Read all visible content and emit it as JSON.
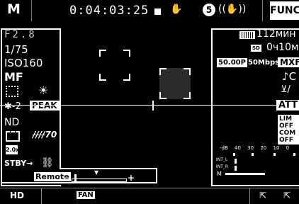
{
  "top": {
    "mode": "M",
    "timecode": "0:04:03:25",
    "rec_icon": "stop-square-icon",
    "stabilizer_icon": "hand-stabilizer-icon",
    "assign_number": "5",
    "func_label": "FUNC."
  },
  "left": {
    "aperture": "F2.8",
    "shutter": "1/75",
    "iso": "ISO160",
    "mf": "MF",
    "focus_guide_icon": "focus-guide-icon",
    "white_balance_icon": "sun-icon",
    "peaking_prefix": "-2",
    "peaking_label": "PEAK",
    "nd_label": "ND",
    "frame_icon": "frame-icon",
    "zebra_value": "70",
    "zoom_icon": "2.0x",
    "standby_label": "STBY",
    "remote_label": "Remote",
    "exposure_minus": "−",
    "exposure_plus": "+"
  },
  "right": {
    "battery_time": "112мин",
    "card_label": "SD",
    "card_time": "0ч10м",
    "framerate": "50.00P",
    "bitrate": "50Mbps",
    "format": "MXF",
    "audio_label": "♪C",
    "att_label": "ATT",
    "lim_label": "LIM OFF",
    "com_label": "COM OFF",
    "meter_scale": [
      "-dB",
      "40",
      "30",
      "20",
      "10",
      "0"
    ],
    "meter_int_l": "INT_L",
    "meter_int_r": "INT_R",
    "meter_m": "M"
  },
  "bottom": {
    "hd_label": "HD",
    "fan_label": "FAN"
  }
}
